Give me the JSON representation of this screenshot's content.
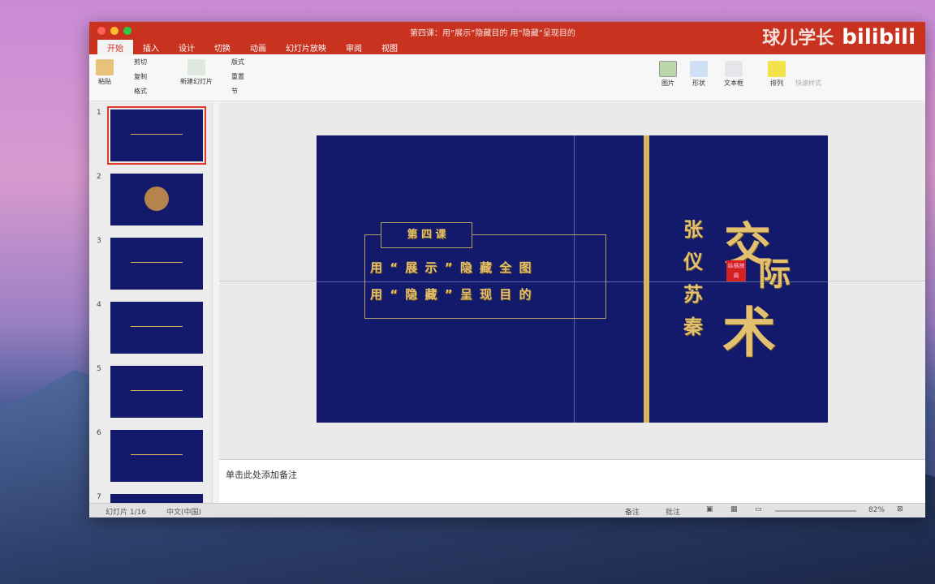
{
  "window": {
    "title": "第四课：用“展示”隐藏目的 用“隐藏”呈现目的",
    "watermark": "球儿学长",
    "watermark_logo": "bilibili"
  },
  "tabs": [
    "开始",
    "插入",
    "设计",
    "切换",
    "动画",
    "幻灯片放映",
    "审阅",
    "视图"
  ],
  "ribbon": {
    "paste": "粘贴",
    "cut": "剪切",
    "copy": "复制",
    "format": "格式",
    "new_slide": "新建幻灯片",
    "layout": "版式",
    "reset": "重置",
    "section": "节",
    "picture": "图片",
    "shape": "形状",
    "textbox": "文本框",
    "arrange": "排列",
    "quick_styles": "快速样式"
  },
  "slide": {
    "lesson": "第 四 课",
    "line1": "用 “ 展 示 ” 隐 藏 全 图",
    "line2": "用 “ 隐 藏 ” 呈 现 目 的",
    "names": "张仪苏秦",
    "big1": "交",
    "big2": "际",
    "big3": "术",
    "stamp": "纵横捭阖"
  },
  "notes": {
    "placeholder": "单击此处添加备注"
  },
  "status": {
    "slide": "幻灯片 1/16",
    "lang": "中文(中国)",
    "notes": "备注",
    "comments": "批注",
    "zoom": "82%"
  },
  "thumbnails": [
    "1",
    "2",
    "3",
    "4",
    "5",
    "6",
    "7"
  ]
}
